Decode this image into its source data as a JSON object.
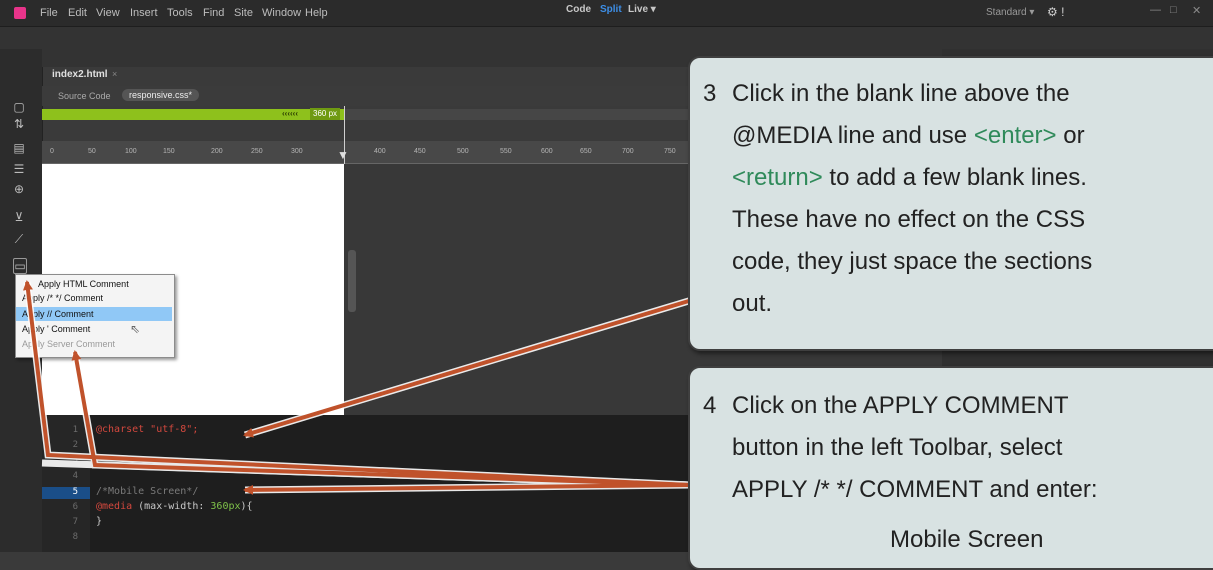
{
  "menubar": {
    "items": [
      "File",
      "Edit",
      "View",
      "Insert",
      "Tools",
      "Find",
      "Site",
      "Window",
      "Help"
    ],
    "workspace": "Standard ▾",
    "gear": "⚙ !"
  },
  "viewbar": {
    "code": "Code",
    "split": "Split",
    "live": "Live ▾"
  },
  "document": {
    "tab_label": "index2.html",
    "tab_close": "×",
    "source_code": "Source Code",
    "related_file": "responsive.css*",
    "media_query_label": "360 px",
    "media_query_marker": "‹‹‹‹‹‹"
  },
  "ruler": {
    "ticks": [
      "0",
      "50",
      "100",
      "150",
      "200",
      "250",
      "300",
      "350",
      "400",
      "450",
      "500",
      "550",
      "600",
      "650",
      "700",
      "750"
    ]
  },
  "popup_menu": {
    "items": [
      "Apply HTML Comment",
      "Apply /* */ Comment",
      "Apply // Comment",
      "Apply ' Comment",
      "Apply Server Comment"
    ],
    "selected_index": 2
  },
  "code": {
    "line_numbers": [
      "1",
      "2",
      "3",
      "4",
      "5",
      "6",
      "7",
      "8"
    ],
    "lines": {
      "l1": "@charset \"utf-8\";",
      "l5": "/*Mobile Screen*/",
      "l6_at": "@media",
      "l6_rest": " (max-width: ",
      "l6_val": "360px",
      "l6_end": "){",
      "l7": "}"
    }
  },
  "callout_1": {
    "number": "3",
    "line1": "Click in the blank line above the",
    "line2_a": "@MEDIA line and use ",
    "line2_b": "<enter>",
    "line2_c": " or",
    "line3_a": "<return>",
    "line3_b": " to add a few blank lines.",
    "line4": "These have no effect on the CSS",
    "line5": "code, they just space the sections",
    "line6": "out."
  },
  "callout_2": {
    "number": "4",
    "line1": "Click on the APPLY COMMENT",
    "line2": "button in the left Toolbar, select",
    "line3": "APPLY /* */ COMMENT and enter:",
    "line4": "Mobile Screen"
  },
  "colors": {
    "accent_green": "#2f8a5a",
    "arrow": "#c0522b",
    "callout_bg": "#d8e2e2",
    "media_bar": "#8ec11c"
  }
}
